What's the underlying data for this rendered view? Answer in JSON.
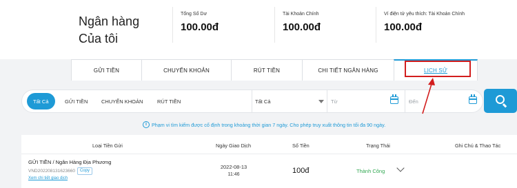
{
  "header": {
    "title_line1": "Ngân hàng",
    "title_line2": "Của tôi",
    "balances": [
      {
        "label": "Tổng Số Dư",
        "value": "100.00đ"
      },
      {
        "label": "Tài Khoản Chính",
        "value": "100.00đ"
      },
      {
        "label": "Ví điện tử yêu thích: Tài Khoản Chính",
        "value": "100.00đ"
      }
    ]
  },
  "tabs": [
    {
      "label": "GỬI TIỀN"
    },
    {
      "label": "CHUYỂN KHOẢN"
    },
    {
      "label": "RÚT TIỀN"
    },
    {
      "label": "CHI TIẾT NGÂN HÀNG"
    },
    {
      "label": "LỊCH SỬ",
      "active": true
    }
  ],
  "filters": {
    "chips": [
      "Tất Cả",
      "GỬI TIỀN",
      "CHUYỂN KHOẢN",
      "RÚT TIỀN"
    ],
    "status_select": "Tất Cả",
    "from_placeholder": "Từ",
    "to_placeholder": "Đến"
  },
  "notice": {
    "icon": "i",
    "text": "Phạm vi tìm kiếm được cố định trong khoảng thời gian 7 ngày. Cho phép truy xuất thông tin tối đa 90 ngày."
  },
  "table": {
    "headers": [
      "Loại Tiền Gửi",
      "Ngày Giao Dịch",
      "Số Tiền",
      "Trạng Thái",
      "Ghi Chú & Thao Tác"
    ],
    "rows": [
      {
        "type": "GỬI TIỀN / Ngân Hàng Địa Phương",
        "ref": "VND202208131623660",
        "copy_label": "Copy",
        "detail_link": "Xem chi tiết giao dịch",
        "date": "2022-08-13",
        "time": "11:46",
        "amount": "100đ",
        "status": "Thành Công"
      }
    ]
  },
  "colors": {
    "accent": "#1e9ad6",
    "highlight": "#d21d1d",
    "success": "#32a852"
  },
  "icons": [
    "calendar-icon",
    "search-icon",
    "info-icon",
    "chevron-down-icon",
    "caret-down-icon"
  ]
}
